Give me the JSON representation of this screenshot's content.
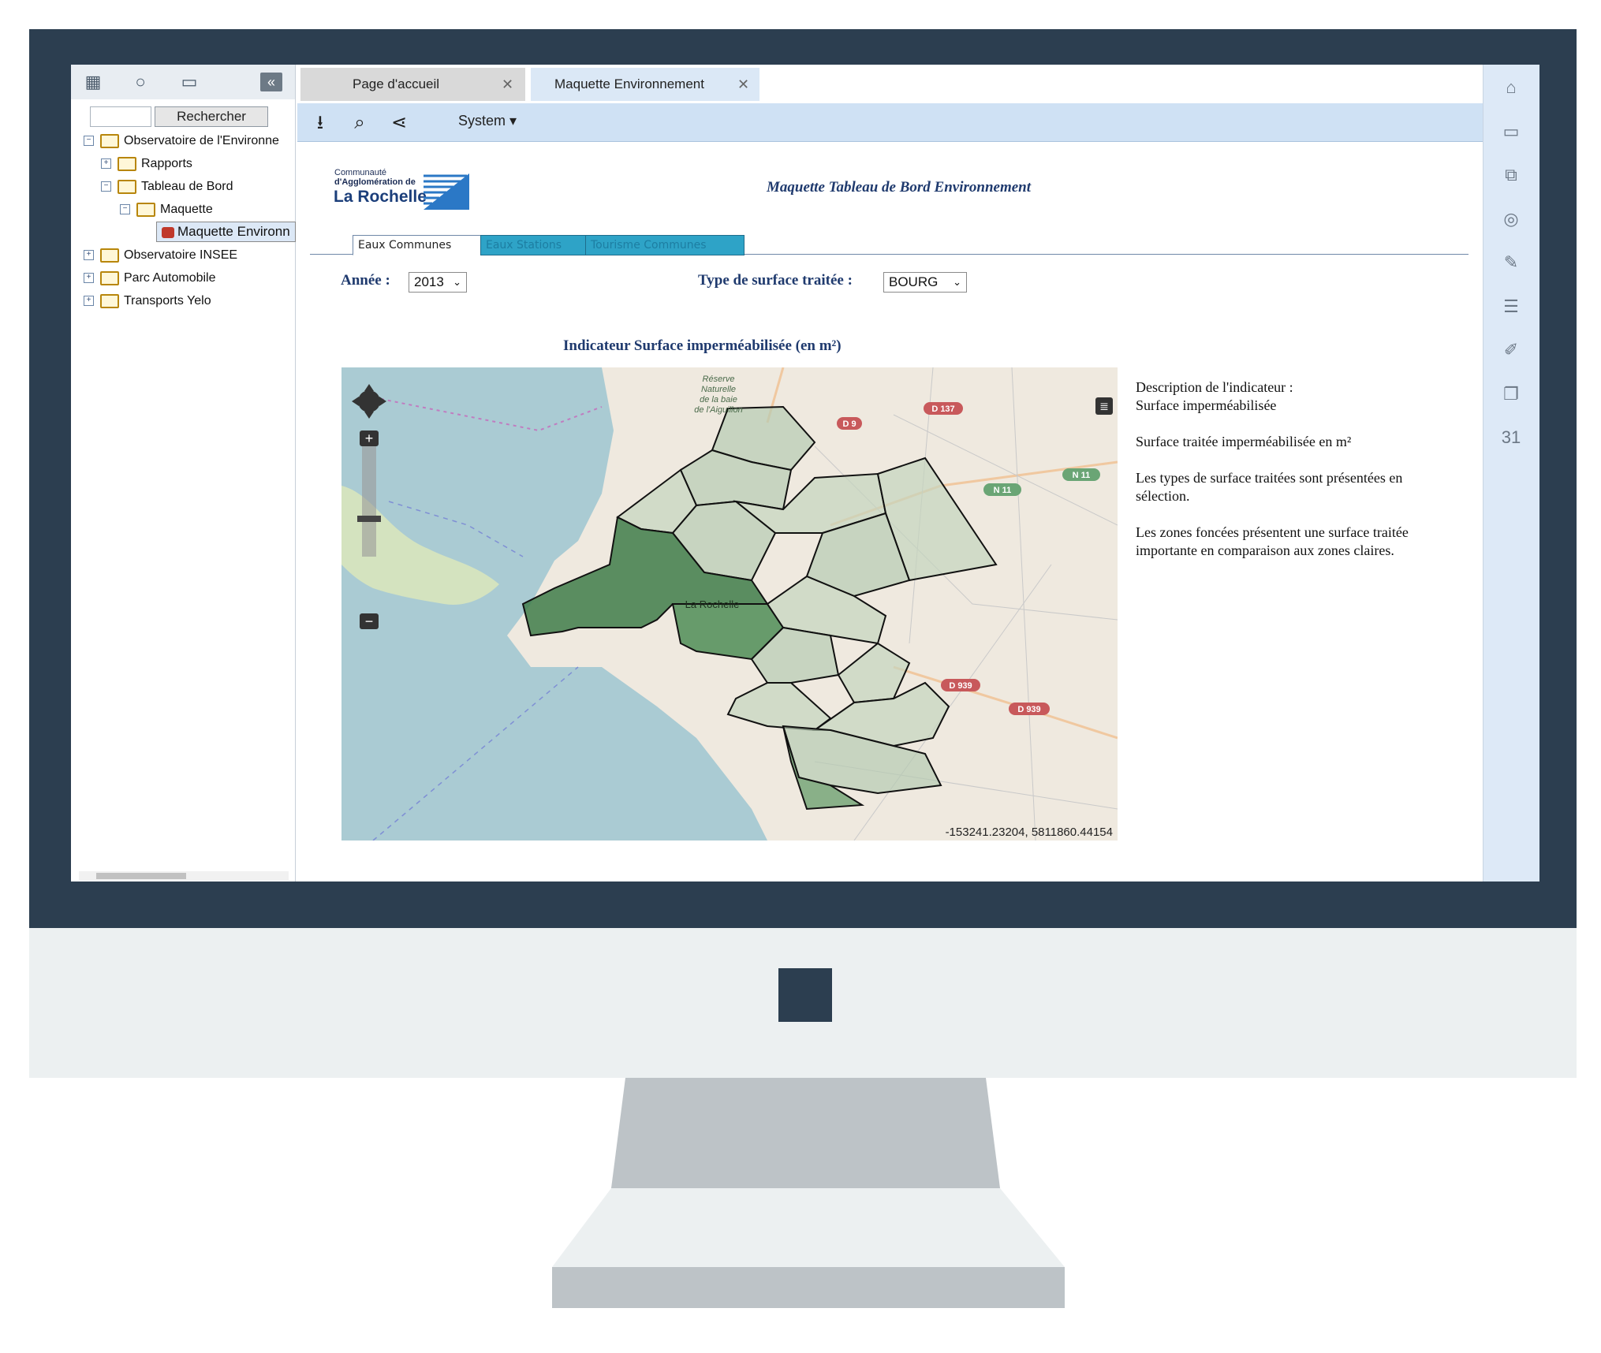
{
  "left_panel": {
    "search_button": "Rechercher",
    "search_value": "",
    "tree": [
      {
        "label": "Observatoire de l'Environne",
        "level": 0,
        "expanded": true
      },
      {
        "label": "Rapports",
        "level": 1,
        "expanded": false
      },
      {
        "label": "Tableau de Bord",
        "level": 1,
        "expanded": true
      },
      {
        "label": "Maquette",
        "level": 2,
        "expanded": true
      },
      {
        "label": "Maquette Environn",
        "level": 3,
        "selected": true
      },
      {
        "label": "Observatoire INSEE",
        "level": 0,
        "expanded": false
      },
      {
        "label": "Parc Automobile",
        "level": 0,
        "expanded": false
      },
      {
        "label": "Transports Yelo",
        "level": 0,
        "expanded": false
      }
    ]
  },
  "tabs": [
    {
      "label": "Page d'accueil"
    },
    {
      "label": "Maquette Environnement"
    }
  ],
  "toolbar": {
    "system_label": "System"
  },
  "content": {
    "logo_line1": "Communauté",
    "logo_line2": "d'Agglomération de",
    "logo_big": "La Rochelle",
    "title": "Maquette Tableau de Bord Environnement",
    "content_tabs": [
      "Eaux Communes",
      "Eaux Stations",
      "Tourisme Communes"
    ],
    "annee_label": "Année :",
    "annee_value": "2013",
    "type_label": "Type de surface traitée :",
    "type_value": "BOURG",
    "indicator_title": "Indicateur Surface imperméabilisée (en m²)",
    "description": [
      "Description de l'indicateur :",
      "Surface imperméabilisée",
      "Surface traitée imperméabilisée en m²",
      "Les types de surface traitées sont présentées en sélection.",
      "Les zones foncées présentent une surface traitée importante en comparaison aux zones claires."
    ],
    "map": {
      "coords": "-153241.23204, 5811860.44154",
      "labels": {
        "reserve1": "Réserve",
        "reserve2": "Naturelle",
        "reserve3": "de la baie",
        "reserve4": "de l'Aiguillon",
        "city": "La Rochelle",
        "d9": "D 9",
        "d137": "D 137",
        "n11a": "N 11",
        "n11b": "N 11",
        "d939": "D 939",
        "d939b": "D 939"
      }
    }
  },
  "colors": {
    "bezel": "#2c3e50",
    "accent_blue": "#1f3a6e",
    "tab_cyan": "#2ea3c7",
    "sea": "#aacbd3",
    "zone_dark": "#3f7d4a"
  }
}
